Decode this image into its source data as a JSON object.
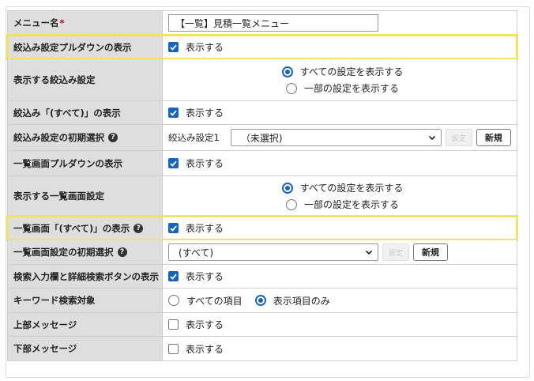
{
  "rows": {
    "menu_name": {
      "label": "メニュー名",
      "required": "*",
      "value": "【一覧】見積一覧メニュー"
    },
    "filter_pulldown": {
      "label": "絞込み設定プルダウンの表示",
      "checkbox": "表示する"
    },
    "filter_setting": {
      "label": "表示する絞込み設定",
      "opt1": "すべての設定を表示する",
      "opt2": "一部の設定を表示する"
    },
    "filter_all": {
      "label": "絞込み「(すべて)」の表示",
      "checkbox": "表示する"
    },
    "filter_initial": {
      "label": "絞込み設定の初期選択",
      "help": "?",
      "prefix": "絞込み設定1",
      "select": "（未選択)",
      "setting_btn": "設定",
      "new_btn": "新規"
    },
    "list_pulldown": {
      "label": "一覧画面プルダウンの表示",
      "checkbox": "表示する"
    },
    "list_setting": {
      "label": "表示する一覧画面設定",
      "opt1": "すべての設定を表示する",
      "opt2": "一部の設定を表示する"
    },
    "list_all": {
      "label": "一覧画面「(すべて)」の表示",
      "help": "?",
      "checkbox": "表示する"
    },
    "list_initial": {
      "label": "一覧画面設定の初期選択",
      "help": "?",
      "select": "(すべて)",
      "setting_btn": "設定",
      "new_btn": "新規"
    },
    "search_box": {
      "label": "検索入力欄と詳細検索ボタンの表示",
      "checkbox": "表示する"
    },
    "keyword_target": {
      "label": "キーワード検索対象",
      "opt1": "すべての項目",
      "opt2": "表示項目のみ"
    },
    "top_message": {
      "label": "上部メッセージ",
      "checkbox": "表示する"
    },
    "bottom_message": {
      "label": "下部メッセージ",
      "checkbox": "表示する"
    }
  },
  "colors": {
    "accent": "#1565c0",
    "highlight": "#f3e26a",
    "label_bg": "#dedede"
  }
}
